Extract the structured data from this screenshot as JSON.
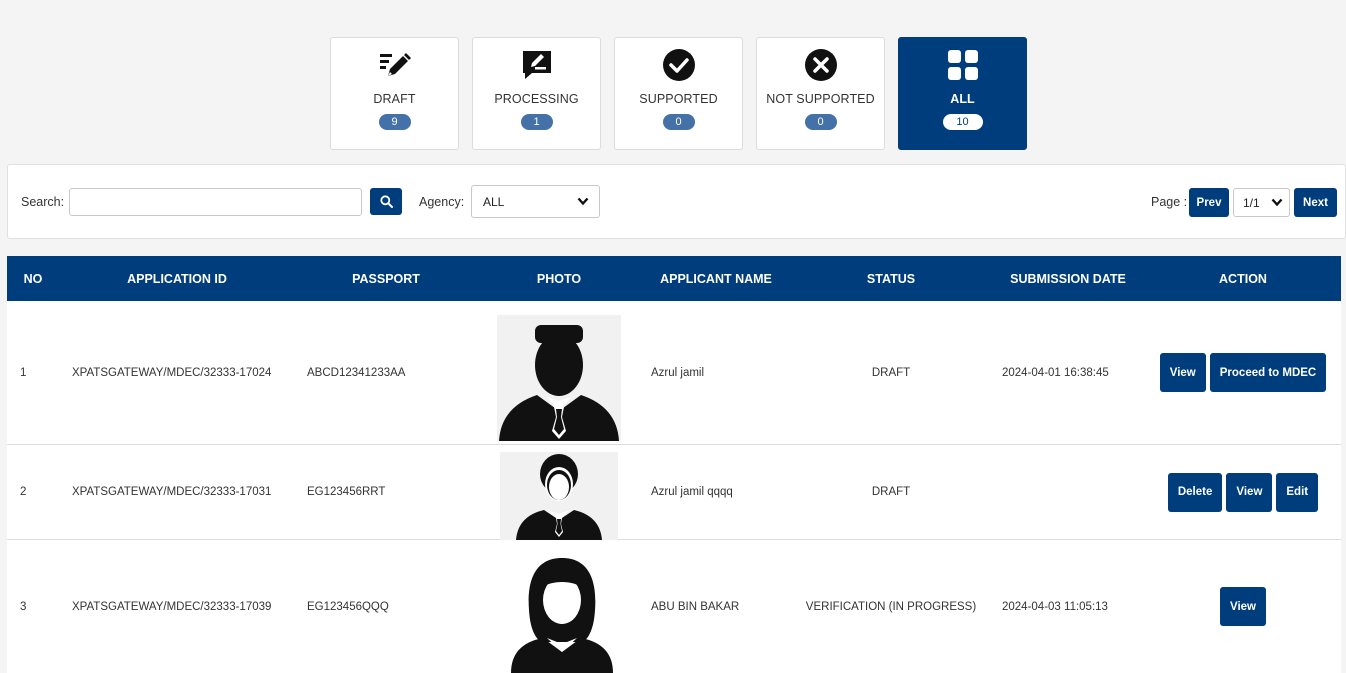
{
  "cards": [
    {
      "label": "DRAFT",
      "count": "9",
      "icon": "pen-draft-icon"
    },
    {
      "label": "PROCESSING",
      "count": "1",
      "icon": "processing-edit-icon"
    },
    {
      "label": "SUPPORTED",
      "count": "0",
      "icon": "check-circle-icon"
    },
    {
      "label": "NOT SUPPORTED",
      "count": "0",
      "icon": "x-circle-icon"
    },
    {
      "label": "ALL",
      "count": "10",
      "icon": "grid-icon"
    }
  ],
  "filter": {
    "search_label": "Search:",
    "search_value": "",
    "agency_label": "Agency:",
    "agency_value": "ALL",
    "page_label": "Page :",
    "prev_label": "Prev",
    "page_value": "1/1",
    "next_label": "Next"
  },
  "table": {
    "headers": [
      "NO",
      "APPLICATION ID",
      "PASSPORT",
      "PHOTO",
      "APPLICANT NAME",
      "STATUS",
      "SUBMISSION DATE",
      "ACTION"
    ],
    "rows": [
      {
        "no": "1",
        "app_id": "XPATSGATEWAY/MDEC/32333-17024",
        "passport": "ABCD12341233AA",
        "photo": "male-avatar",
        "name": "Azrul jamil",
        "status": "DRAFT",
        "date": "2024-04-01 16:38:45",
        "actions": [
          "View",
          "Proceed to MDEC"
        ]
      },
      {
        "no": "2",
        "app_id": "XPATSGATEWAY/MDEC/32333-17031",
        "passport": "EG123456RRT",
        "photo": "male-avatar",
        "name": "Azrul jamil qqqq",
        "status": "DRAFT",
        "date": "",
        "actions": [
          "Delete",
          "View",
          "Edit"
        ]
      },
      {
        "no": "3",
        "app_id": "XPATSGATEWAY/MDEC/32333-17039",
        "passport": "EG123456QQQ",
        "photo": "female-avatar",
        "name": "ABU BIN BAKAR",
        "status": "VERIFICATION (IN PROGRESS)",
        "date": "2024-04-03 11:05:13",
        "actions": [
          "View"
        ]
      }
    ]
  },
  "colors": {
    "primary": "#003d7c",
    "badge": "#4472a8"
  }
}
